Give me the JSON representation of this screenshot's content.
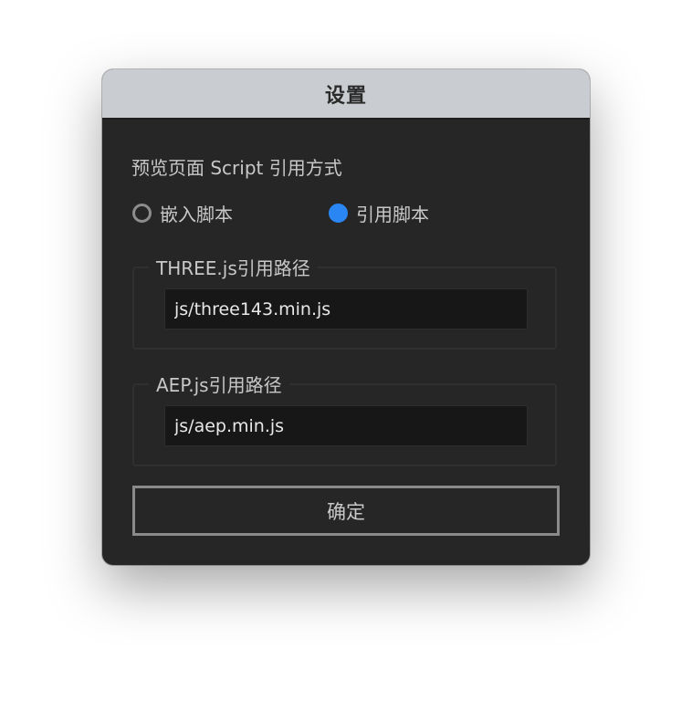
{
  "dialog": {
    "title": "设置",
    "section_label": "预览页面 Script 引用方式",
    "radios": [
      {
        "label": "嵌入脚本",
        "checked": false
      },
      {
        "label": "引用脚本",
        "checked": true
      }
    ],
    "accent_color": "#2a86f3",
    "three_group": {
      "legend": "THREE.js引用路径",
      "value": "js/three143.min.js"
    },
    "aep_group": {
      "legend": "AEP.js引用路径",
      "value": "js/aep.min.js"
    },
    "confirm_label": "确定"
  }
}
